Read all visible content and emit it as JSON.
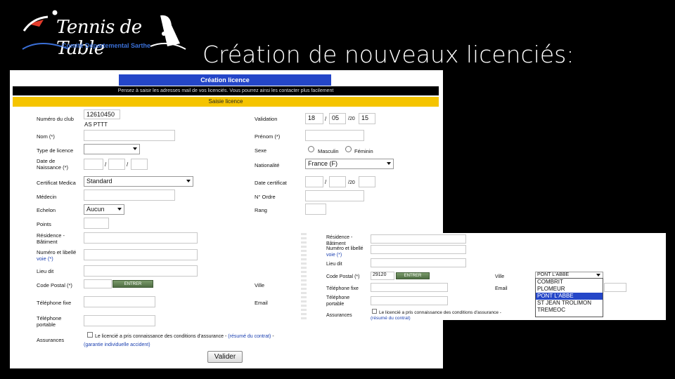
{
  "slide": {
    "title": "Création de nouveaux licenciés:",
    "logo_text": "Tennis de Table",
    "logo_subtitle": "Comité Départemental Sarthe"
  },
  "form": {
    "tab_title": "Création licence",
    "info_text": "Pensez à saisir les adresses mail de vos licenciés. Vous pourrez ainsi les contacter plus facilement",
    "section_title": "Saisie licence",
    "left": {
      "club_label": "Numéro du club",
      "club_value": "12610450",
      "club_name": "AS PTTT",
      "nom_label": "Nom (*)",
      "type_label": "Type de licence",
      "naissance_label_1": "Date de",
      "naissance_label_2": "Naissance (*)",
      "certificat_label": "Certificat Medica",
      "certificat_value": "Standard",
      "medecin_label": "Médecin",
      "echelon_label": "Echelon",
      "echelon_value": "Aucun",
      "points_label": "Points",
      "residence_label_1": "Résidence -",
      "residence_label_2": "Bâtiment",
      "voie_label_1": "Numéro et libellé",
      "voie_label_2": "voie (*)",
      "lieudit_label": "Lieu dit",
      "cp_label": "Code Postal (*)",
      "cp_button": "ENTRER",
      "tel_fixe_label": "Téléphone fixe",
      "tel_port_label_1": "Téléphone",
      "tel_port_label_2": "portable",
      "assurances_label": "Assurances",
      "assurance_text": "Le licencié a pris connaissance des conditions d'assurance -",
      "link_resume": "(résumé du contrat)",
      "link_garantie": "(garantie individuelle accident)",
      "valider": "Valider"
    },
    "right": {
      "validation_label": "Validation",
      "validation_day": "18",
      "validation_month": "05",
      "validation_year_prefix": "/20",
      "validation_year": "15",
      "prenom_label": "Prénom (*)",
      "sexe_label": "Sexe",
      "sexe_m": "Masculin",
      "sexe_f": "Féminin",
      "nationalite_label": "Nationalité",
      "nationalite_value": "France (F)",
      "date_certif_label": "Date certificat",
      "date_certif_year_prefix": "/20",
      "ordre_label": "N° Ordre",
      "rang_label": "Rang",
      "ville_label": "Ville",
      "email_label": "Email"
    }
  },
  "zoom": {
    "residence_label_1": "Résidence -",
    "residence_label_2": "Bâtiment",
    "voie_label_1": "Numéro et libellé",
    "voie_label_2": "voie (*)",
    "lieudit_label": "Lieu dit",
    "cp_label": "Code Postal (*)",
    "cp_value": "29120",
    "cp_button": "ENTRER",
    "ville_label": "Ville",
    "ville_value": "PONT L'ABBE",
    "tel_fixe_label": "Téléphone fixe",
    "email_label": "Email",
    "tel_port_label_1": "Téléphone",
    "tel_port_label_2": "portable",
    "assurances_label": "Assurances",
    "assurance_text": "Le licencié a pris connaissance des conditions d'assurance -",
    "link_resume": "(résumé du contrat)",
    "ville_options": [
      "COMBRIT",
      "PLOMEUR",
      "PONT L'ABBE",
      "ST JEAN TROLIMON",
      "TREMEOC"
    ],
    "ville_selected_index": 2
  },
  "colors": {
    "tab_blue": "#2446c8",
    "section_yellow": "#f5c400",
    "link_blue": "#1a3fb0"
  }
}
